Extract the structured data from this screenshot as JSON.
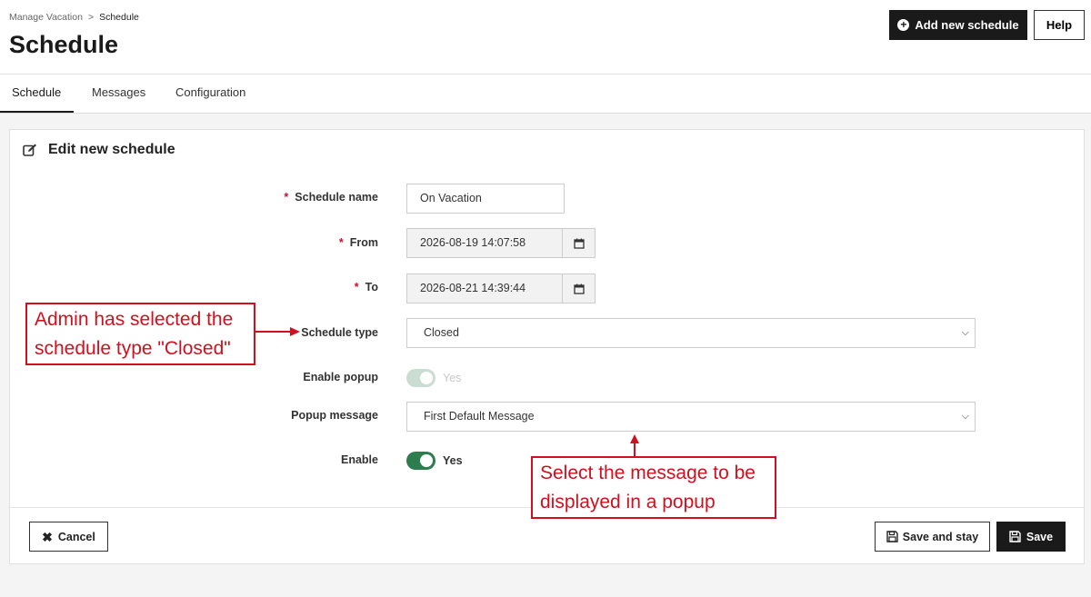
{
  "header": {
    "breadcrumb": [
      "Manage Vacation",
      "Schedule"
    ],
    "breadcrumb_sep": ">",
    "title": "Schedule",
    "add_button": "Add new schedule",
    "help_button": "Help"
  },
  "tabs": [
    {
      "label": "Schedule",
      "active": true
    },
    {
      "label": "Messages",
      "active": false
    },
    {
      "label": "Configuration",
      "active": false
    }
  ],
  "form": {
    "title": "Edit new schedule",
    "required_mark": "*",
    "name_label": "Schedule name",
    "name_value": "On Vacation",
    "from_label": "From",
    "from_value": "2026-08-19 14:07:58",
    "to_label": "To",
    "to_value": "2026-08-21 14:39:44",
    "type_label": "Schedule type",
    "type_value": "Closed",
    "popup_label": "Enable popup",
    "popup_state": "Yes",
    "popup_enabled": false,
    "message_label": "Popup message",
    "message_value": "First Default Message",
    "enable_label": "Enable",
    "enable_state": "Yes",
    "enable_on": true
  },
  "footer": {
    "cancel": "Cancel",
    "save_stay": "Save and stay",
    "save": "Save"
  },
  "annotations": {
    "schedule_type": [
      "Admin has selected the",
      "schedule type \"Closed\""
    ],
    "popup_message": [
      "Select the message to be",
      "displayed in a popup"
    ]
  },
  "colors": {
    "toggle_on": "#2e7d4f",
    "toggle_disabled": "#c9ddd2",
    "annotation": "#d0101e",
    "required": "#c8102e"
  }
}
